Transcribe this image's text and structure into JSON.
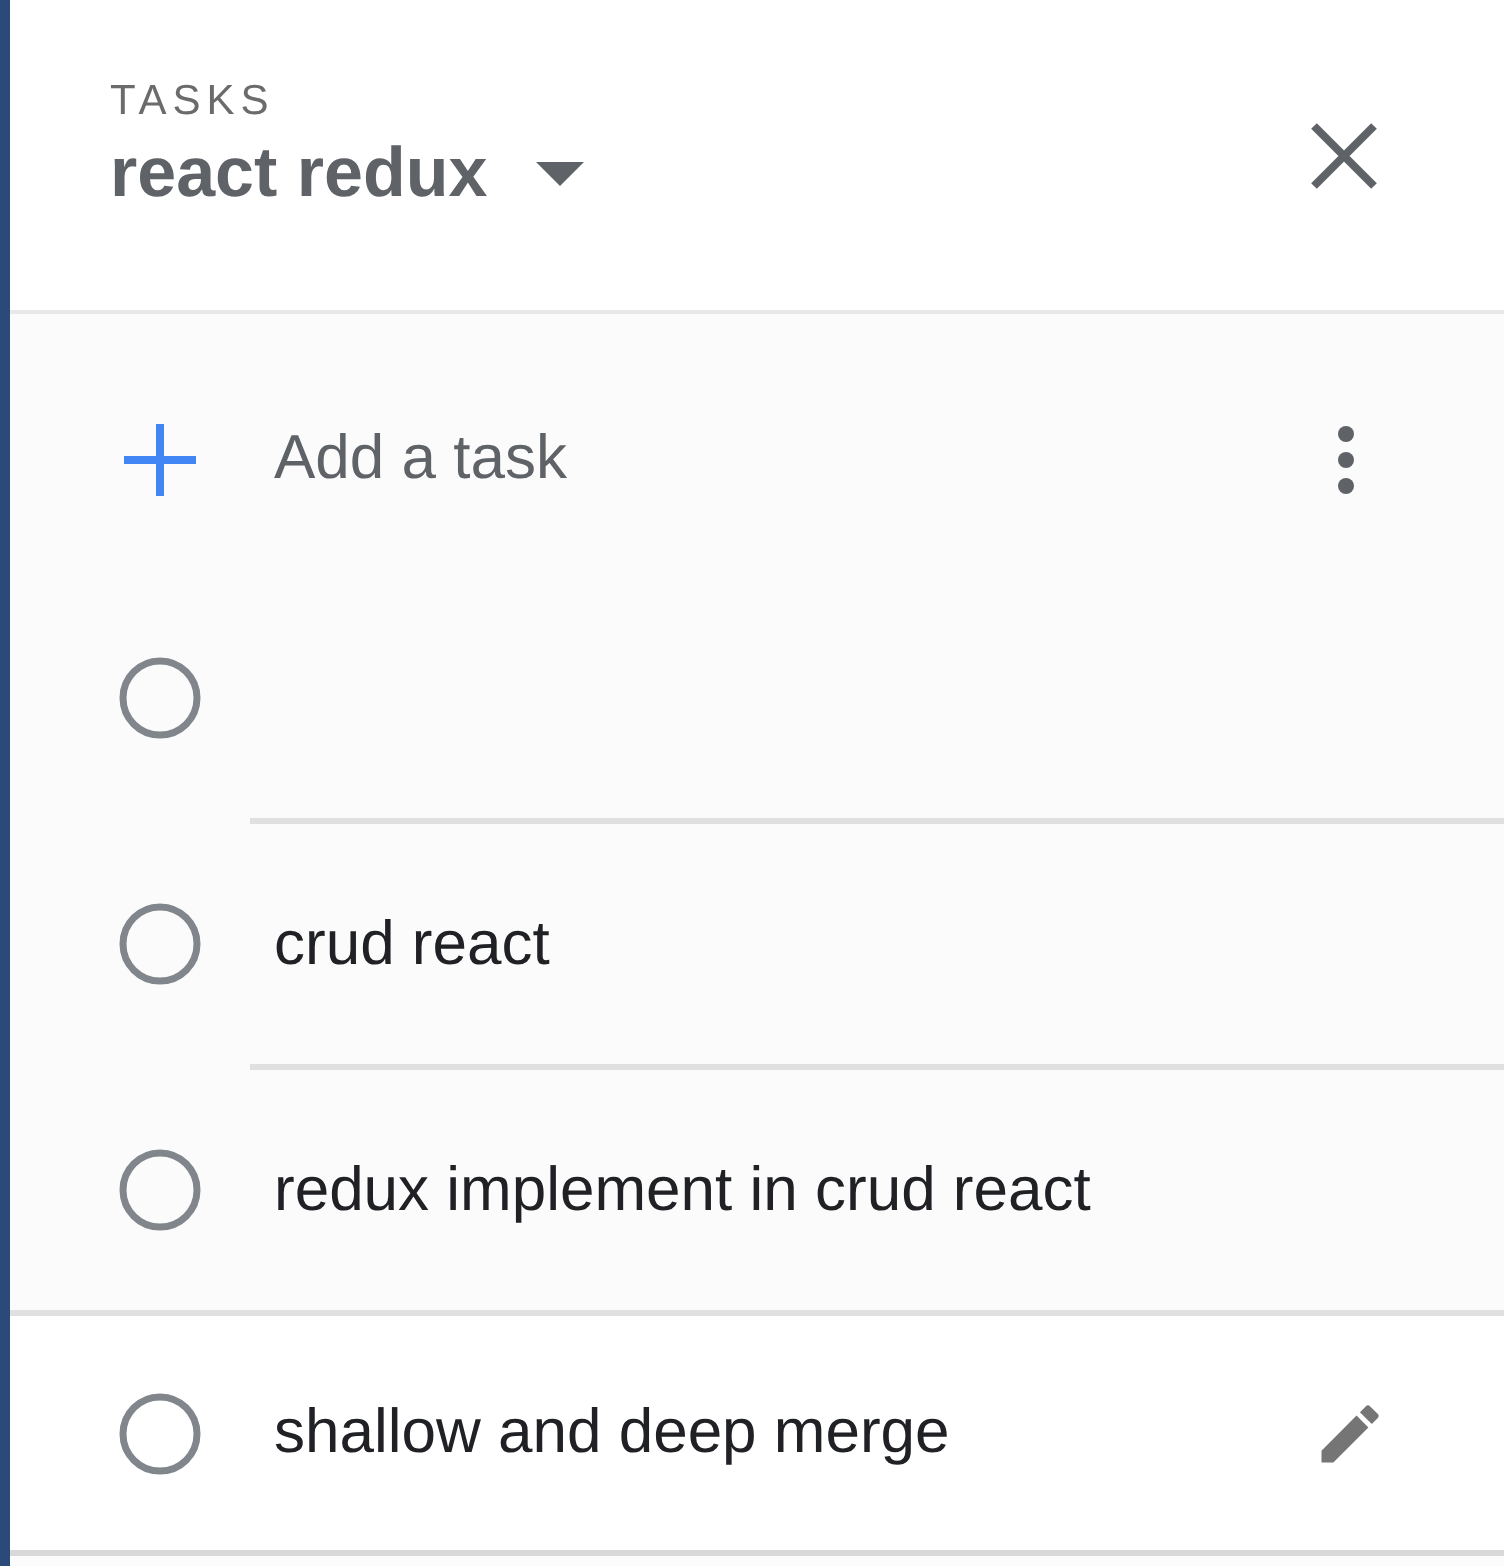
{
  "header": {
    "label": "TASKS",
    "list_name": "react redux"
  },
  "add_task": {
    "label": "Add a task"
  },
  "tasks": [
    {
      "completed": false,
      "hovered": false
    },
    {
      "title": "crud react",
      "completed": false,
      "hovered": false
    },
    {
      "title": "redux implement in crud react",
      "completed": false,
      "hovered": false
    },
    {
      "title": "shallow and deep merge",
      "completed": false,
      "hovered": true
    }
  ]
}
